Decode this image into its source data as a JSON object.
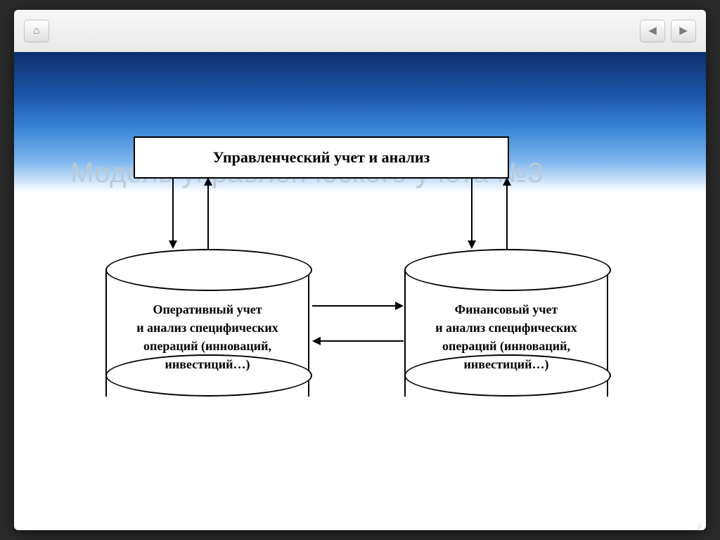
{
  "slide": {
    "title": "Модель управленческого учета №3"
  },
  "diagram": {
    "top_box": "Управленческий учет и анализ",
    "left_cylinder": "Оперативный учет\nи анализ специфических\nопераций (инноваций,\nинвестиций…)",
    "right_cylinder": "Финансовый учет\nи анализ специфических\nопераций (инноваций,\nинвестиций…)"
  },
  "nav": {
    "home": "⌂",
    "prev": "◀",
    "next": "▶"
  }
}
